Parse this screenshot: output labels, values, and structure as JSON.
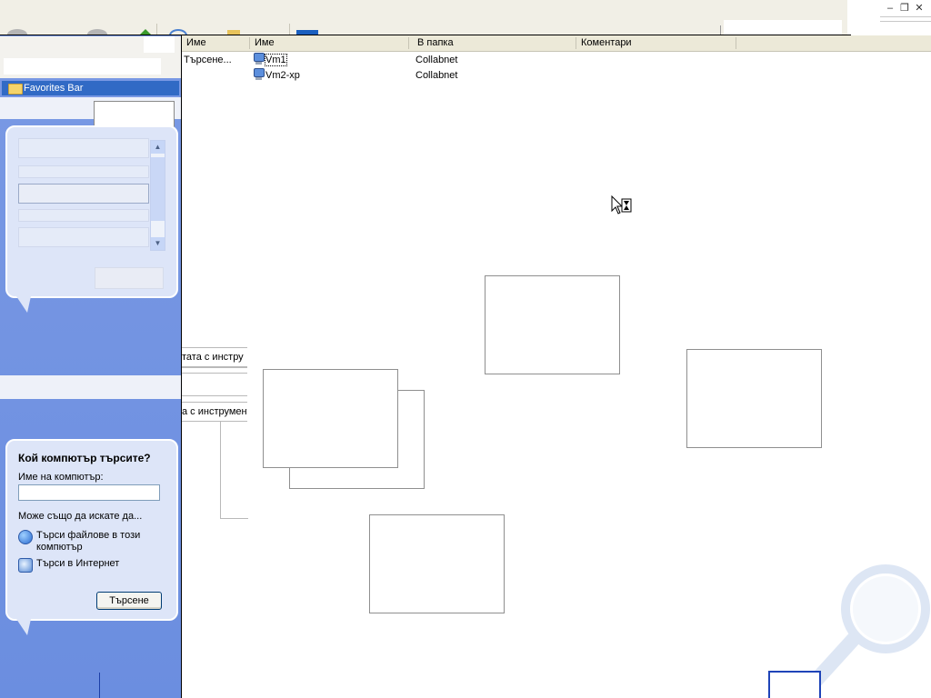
{
  "left_pane": {
    "favorites_bar_label": "Favorites Bar",
    "search_balloon": {
      "title": "Кой компютър търсите?",
      "computer_name_label": "Име на компютър:",
      "computer_name_value": "",
      "also_label": "Може също да искате да...",
      "links": [
        {
          "label": "Търси файлове в този компютър",
          "icon": "globe-search-icon"
        },
        {
          "label": "Търси в Интернет",
          "icon": "internet-search-icon"
        }
      ],
      "search_button": "Търсене"
    }
  },
  "results": {
    "columns": [
      "Име",
      "Име",
      "В папка",
      "Коментари"
    ],
    "search_status": "Търсене...",
    "rows": [
      {
        "name": "Vm1",
        "folder": "Collabnet",
        "icon": "computer-icon",
        "selected": true
      },
      {
        "name": "Vm2-xp",
        "folder": "Collabnet",
        "icon": "computer-icon",
        "selected": false
      }
    ]
  },
  "overlays": {
    "toolbar_text_1": "тата с инстру",
    "toolbar_text_2": "а с инструмент"
  },
  "colors": {
    "left_pane_blue": "#6b8ee0",
    "favorites_highlight": "#316ac5",
    "balloon_fill": "#dde5f8",
    "header_bg": "#ece9d8"
  }
}
